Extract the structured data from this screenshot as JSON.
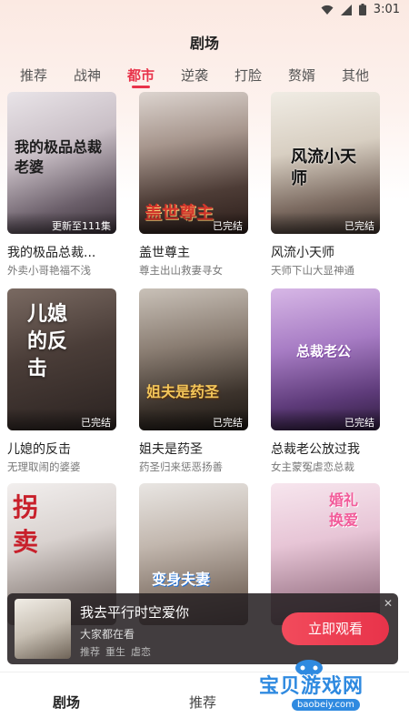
{
  "status_bar": {
    "time": "3:01",
    "icons": [
      "wifi-icon",
      "signal-icon",
      "battery-icon"
    ]
  },
  "header": {
    "title": "剧场"
  },
  "tabs": [
    {
      "label": "推荐"
    },
    {
      "label": "战神"
    },
    {
      "label": "都市"
    },
    {
      "label": "逆袭"
    },
    {
      "label": "打脸"
    },
    {
      "label": "赘婿"
    },
    {
      "label": "其他"
    }
  ],
  "active_tab": "都市",
  "cards": [
    {
      "title": "我的极品总裁...",
      "subtitle": "外卖小哥艳福不浅",
      "badge": "更新至111集",
      "poster_text": "我的极品总裁老婆"
    },
    {
      "title": "盖世尊主",
      "subtitle": "尊主出山救妻寻女",
      "badge": "已完结",
      "poster_text": "盖世尊主"
    },
    {
      "title": "风流小天师",
      "subtitle": "天师下山大显神通",
      "badge": "已完结",
      "poster_text": "风流小天师"
    },
    {
      "title": "儿媳的反击",
      "subtitle": "无理取闹的婆婆",
      "badge": "已完结",
      "poster_text": "儿媳的反击"
    },
    {
      "title": "姐夫是药圣",
      "subtitle": "药圣归来惩恶扬善",
      "badge": "已完结",
      "poster_text": "姐夫是药圣"
    },
    {
      "title": "总裁老公放过我",
      "subtitle": "女主蒙冤虐恋总裁",
      "badge": "已完结",
      "poster_text": "总裁老公"
    },
    {
      "title": "拐卖",
      "subtitle": "",
      "badge": "",
      "poster_text": "拐卖"
    },
    {
      "title": "变身夫妻",
      "subtitle": "",
      "badge": "",
      "poster_text": "变身夫妻"
    },
    {
      "title": "婚礼换爱",
      "subtitle": "",
      "badge": "",
      "poster_text": "婚礼换爱"
    }
  ],
  "mini_player": {
    "title": "我去平行时空爱你",
    "subtitle": "大家都在看",
    "tags": [
      "推荐",
      "重生",
      "虐恋"
    ],
    "watch_label": "立即观看",
    "close_label": "✕"
  },
  "bottom_nav": [
    {
      "label": "剧场"
    },
    {
      "label": "推荐"
    }
  ],
  "watermark": {
    "text": "宝贝游戏网",
    "url": "baobeiy.com"
  },
  "colors": {
    "accent": "#e8334a",
    "watermark": "#2f8ae0"
  }
}
